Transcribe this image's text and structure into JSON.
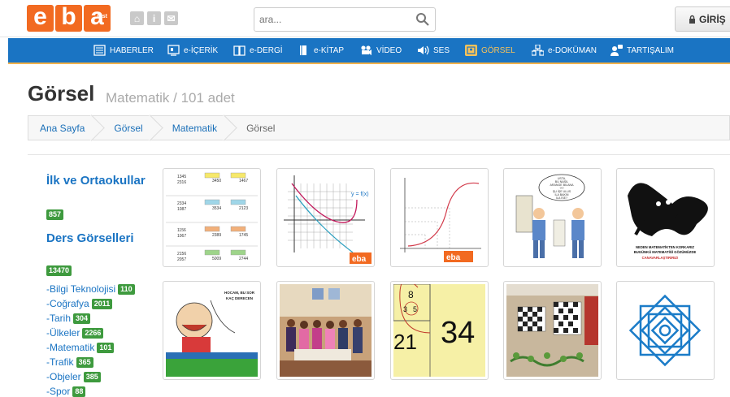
{
  "logo": {
    "letters": [
      "e",
      "b",
      "a"
    ],
    "sub": "test"
  },
  "search": {
    "placeholder": "ara..."
  },
  "login_label": "GİRİŞ",
  "nav": [
    {
      "label": "HABERLER",
      "icon": "news-icon"
    },
    {
      "label": "e-İÇERİK",
      "icon": "content-icon"
    },
    {
      "label": "e-DERGİ",
      "icon": "magazine-icon"
    },
    {
      "label": "e-KİTAP",
      "icon": "book-icon"
    },
    {
      "label": "VİDEO",
      "icon": "video-camera-icon"
    },
    {
      "label": "SES",
      "icon": "speaker-icon"
    },
    {
      "label": "GÖRSEL",
      "icon": "image-icon",
      "active": true
    },
    {
      "label": "e-DOKÜMAN",
      "icon": "document-icon"
    },
    {
      "label": "TARTIŞALIM",
      "icon": "discussion-icon"
    }
  ],
  "page": {
    "title": "Görsel",
    "subtitle": "Matematik / 101 adet"
  },
  "breadcrumb": [
    "Ana Sayfa",
    "Görsel",
    "Matematik",
    "Görsel"
  ],
  "sidebar": {
    "section1": {
      "title": "İlk ve Ortaokullar",
      "count": "857"
    },
    "section2": {
      "title": "Ders Görselleri",
      "count": "13470"
    },
    "items": [
      {
        "label": "-Bilgi Teknolojisi",
        "count": "110"
      },
      {
        "label": "-Coğrafya",
        "count": "2011"
      },
      {
        "label": "-Tarih",
        "count": "304"
      },
      {
        "label": "-Ülkeler",
        "count": "2266"
      },
      {
        "label": "-Matematik",
        "count": "101"
      },
      {
        "label": "-Trafik",
        "count": "365"
      },
      {
        "label": "-Objeler",
        "count": "385"
      },
      {
        "label": "-Spor",
        "count": "88"
      }
    ]
  },
  "thumb_text": {
    "grid_numbers": [
      "1345",
      "2316",
      "3450",
      "1467",
      "2334",
      "1087",
      "3534",
      "2123",
      "1156",
      "1067",
      "2389",
      "1745",
      "2156",
      "2057",
      "5009",
      "2744"
    ],
    "graph_label": "y = f(x)",
    "brand_stamp": "eba",
    "cartoon_lines": [
      "USTA,",
      "BU NASIL",
      "ARANGE BİLANA",
      "?!?",
      "ŞU İŞE ULUS",
      "İLA BAKIN",
      "İLA İSE?"
    ],
    "poster_lines": [
      "NEDEN MATEMATİKTEN KORKARIZ",
      "BUGÜNKÜ MATEMATİĞİ GÖZÜMÜZDE",
      "CANAVARLAŞTIRIRIZ!"
    ],
    "cartoon2_lines": [
      "HOCAM, BU SOR",
      "KAÇ DERECEN"
    ],
    "fib_numbers": [
      "8",
      "3",
      "5",
      "34",
      "21"
    ]
  }
}
